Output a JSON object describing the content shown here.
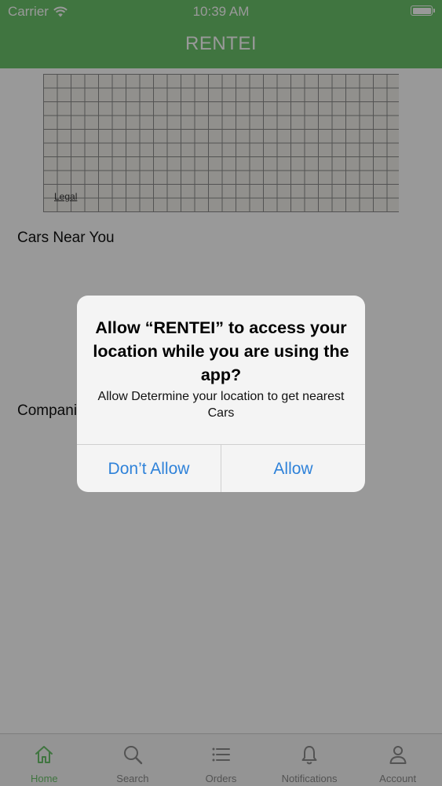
{
  "status_bar": {
    "carrier": "Carrier",
    "time": "10:39 AM",
    "wifi_icon": "wifi-icon",
    "battery_icon": "battery-icon"
  },
  "header": {
    "title": "RENTEI",
    "color": "#6cc46c"
  },
  "map": {
    "legal_label": "Legal"
  },
  "sections": {
    "cars_near_you": "Cars Near You",
    "companies": "Compani"
  },
  "alert": {
    "title": "Allow “RENTEI” to access your location while you are using the app?",
    "message": "Allow Determine your location to get nearest Cars",
    "dont_allow_label": "Don’t Allow",
    "allow_label": "Allow",
    "button_color": "#2f82d9"
  },
  "tab_bar": {
    "active_color": "#6cc46c",
    "tabs": [
      {
        "label": "Home",
        "icon": "home-icon",
        "active": true
      },
      {
        "label": "Search",
        "icon": "search-icon",
        "active": false
      },
      {
        "label": "Orders",
        "icon": "list-icon",
        "active": false
      },
      {
        "label": "Notifications",
        "icon": "bell-icon",
        "active": false
      },
      {
        "label": "Account",
        "icon": "user-icon",
        "active": false
      }
    ]
  }
}
